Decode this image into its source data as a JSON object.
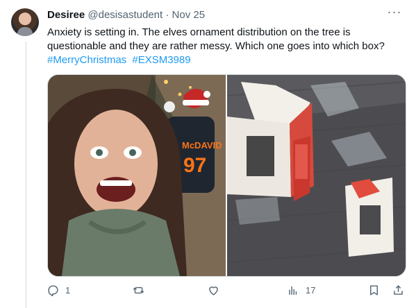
{
  "tweet": {
    "author_name": "Desiree",
    "handle": "@desisastudent",
    "separator": "·",
    "date": "Nov 25",
    "text": "Anxiety is setting in. The elves ornament distribution on the tree is questionable and they are rather messy. Which one goes into which box?",
    "hashtags": [
      "#MerryChristmas",
      "#EXSM3989"
    ],
    "more_icon": "more-icon",
    "photos": [
      {
        "name": "selfie-photo",
        "jersey_text": "McDAVID",
        "jersey_number": "97"
      },
      {
        "name": "boxes-photo"
      }
    ],
    "actions": {
      "reply_count": "1",
      "retweet_count": "",
      "like_count": "",
      "views_count": "17"
    },
    "icons": [
      "reply-icon",
      "retweet-icon",
      "like-icon",
      "views-icon",
      "bookmark-icon",
      "share-icon"
    ]
  },
  "colors": {
    "text": "#0f1419",
    "secondary": "#536471",
    "link": "#1d9bf0",
    "border": "#cfd9de"
  }
}
